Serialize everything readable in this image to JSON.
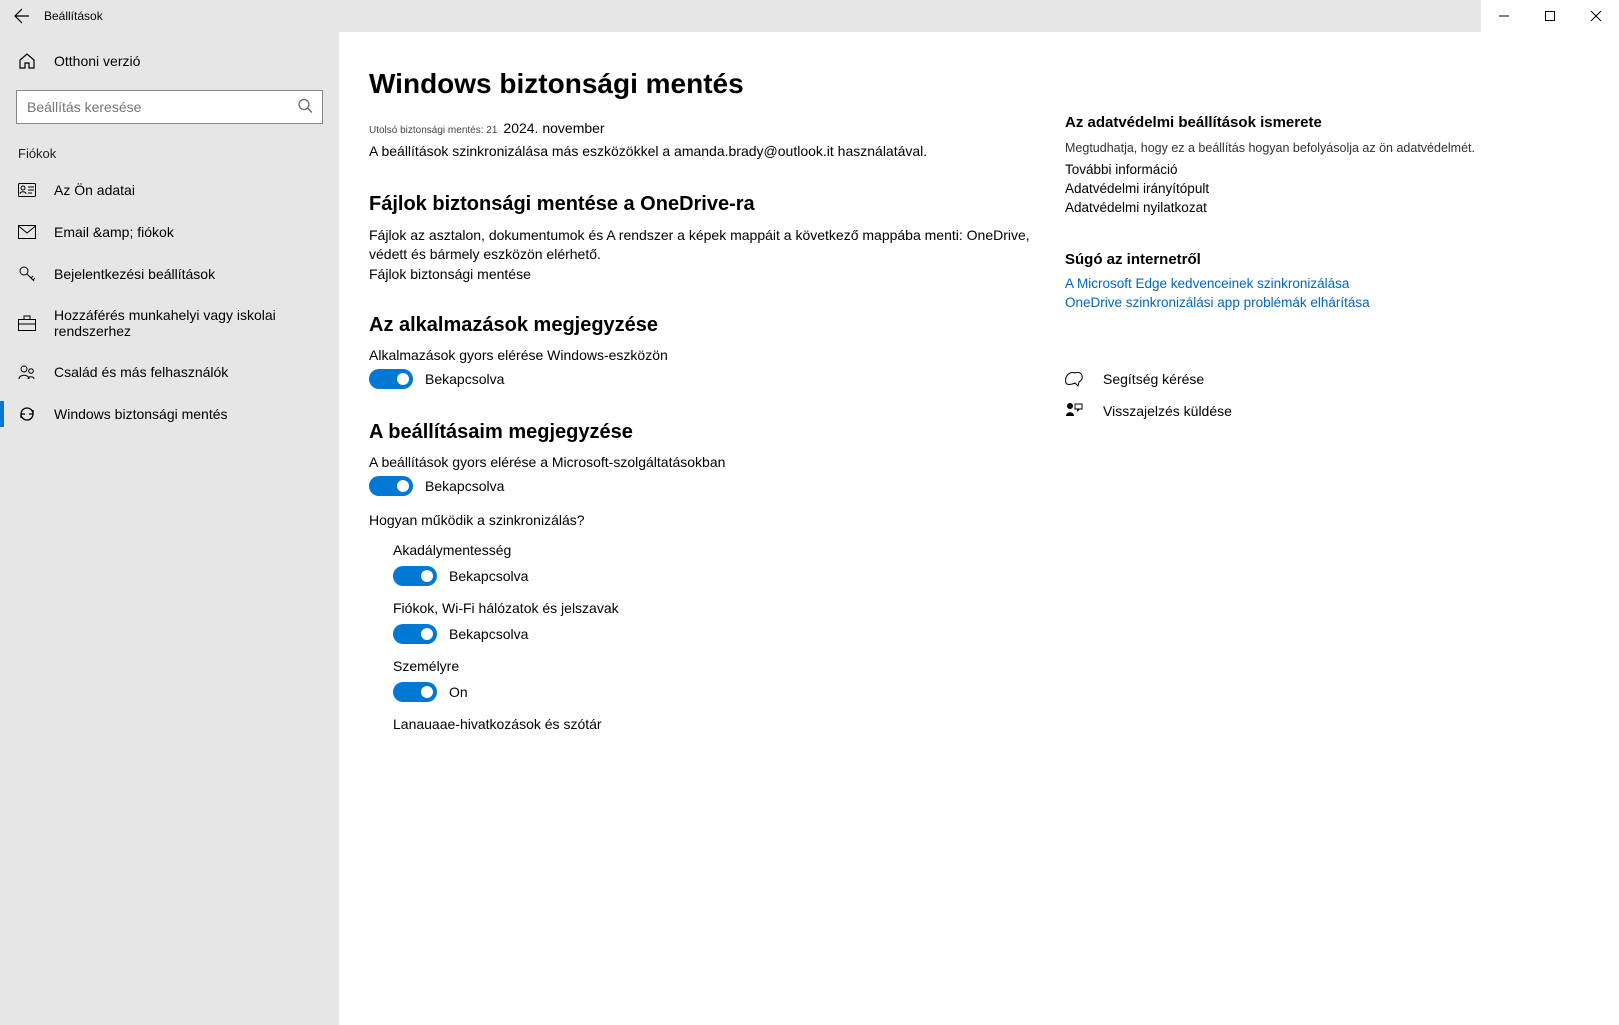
{
  "app_title": "Beállítások",
  "window_buttons": {
    "min": "−",
    "max": "▢",
    "close": "✕"
  },
  "sidebar": {
    "home_label": "Otthoni verzió",
    "search_placeholder": "Beállítás keresése",
    "section_label": "Fiókok",
    "items": [
      {
        "label": "Az Ön adatai",
        "icon": "person-card"
      },
      {
        "label": "Email &amp; fiókok",
        "icon": "mail"
      },
      {
        "label": "Bejelentkezési beállítások",
        "icon": "key"
      },
      {
        "label": "Hozzáférés munkahelyi vagy iskolai rendszerhez",
        "icon": "briefcase"
      },
      {
        "label": "Család és más felhasználók",
        "icon": "people"
      },
      {
        "label": "Windows biztonsági mentés",
        "icon": "sync"
      }
    ],
    "active_index": 5
  },
  "main": {
    "title": "Windows biztonsági mentés",
    "last_backup_label": "Utolsó biztonsági mentés: 21",
    "last_backup_date": "2024. november",
    "sync_desc": "A beállítások szinkronizálása más eszközökkel a amanda.brady@outlook.it használatával.",
    "section_files": {
      "heading": "Fájlok biztonsági mentése a OneDrive-ra",
      "desc": "Fájlok az asztalon, dokumentumok és       A rendszer a képek mappáit a következő mappába menti: OneDrive, védett és bármely eszközön elérhető.",
      "action": "Fájlok biztonsági mentése"
    },
    "section_apps": {
      "heading": "Az alkalmazások megjegyzése",
      "desc": "Alkalmazások gyors elérése Windows-eszközön",
      "toggle_state": "Bekapcsolva"
    },
    "section_settings": {
      "heading": "A beállításaim megjegyzése",
      "desc": "A beállítások gyors elérése a Microsoft-szolgáltatásokban",
      "toggle_state": "Bekapcsolva",
      "how_link": "Hogyan működik a szinkronizálás?",
      "sub": [
        {
          "label": "Akadálymentesség",
          "state": "Bekapcsolva"
        },
        {
          "label": "Fiókok, Wi-Fi hálózatok és jelszavak",
          "state": "Bekapcsolva"
        },
        {
          "label": "Személyre",
          "state": "On"
        },
        {
          "label": "Lanauaae-hivatkozások és szótár",
          "state": ""
        }
      ]
    }
  },
  "aside": {
    "privacy": {
      "heading": "Az adatvédelmi beállítások ismerete",
      "body": "Megtudhatja, hogy ez a beállítás hogyan befolyásolja az ön adatvédelmét.",
      "links": [
        "További információ",
        "Adatvédelmi irányítópult",
        "Adatvédelmi nyilatkozat"
      ]
    },
    "webhelp": {
      "heading": "Súgó az internetről",
      "links": [
        "A Microsoft Edge kedvenceinek szinkronizálása",
        "OneDrive szinkronizálási app problémák elhárítása"
      ]
    },
    "support": {
      "help": "Segítség kérése",
      "feedback": "Visszajelzés küldése"
    }
  }
}
